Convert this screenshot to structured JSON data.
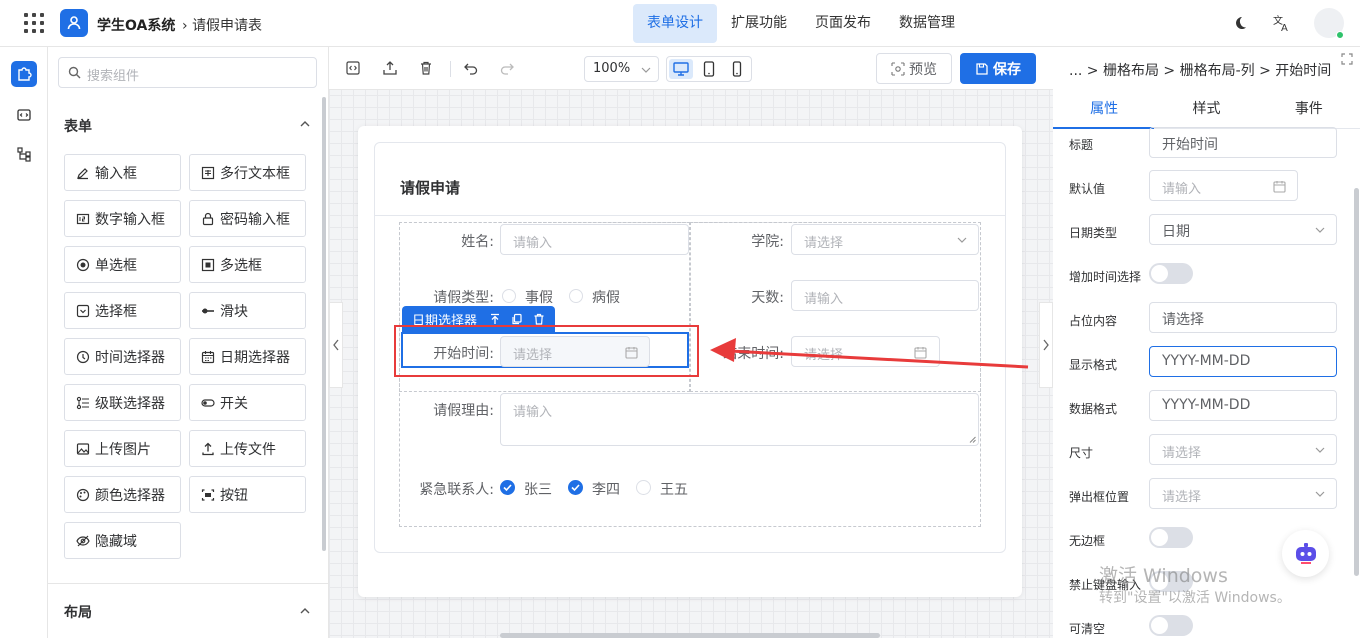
{
  "header": {
    "app_title": "学生OA系统",
    "breadcrumb": "请假申请表",
    "nav": [
      "表单设计",
      "扩展功能",
      "页面发布",
      "数据管理"
    ],
    "active_nav": 0
  },
  "components": {
    "search_placeholder": "搜索组件",
    "form_section": "表单",
    "layout_section": "布局",
    "items": [
      {
        "label": "输入框",
        "icon": "edit-icon"
      },
      {
        "label": "多行文本框",
        "icon": "textarea-icon"
      },
      {
        "label": "数字输入框",
        "icon": "number-icon"
      },
      {
        "label": "密码输入框",
        "icon": "lock-icon"
      },
      {
        "label": "单选框",
        "icon": "radio-icon"
      },
      {
        "label": "多选框",
        "icon": "checkbox-icon"
      },
      {
        "label": "选择框",
        "icon": "select-icon"
      },
      {
        "label": "滑块",
        "icon": "slider-icon"
      },
      {
        "label": "时间选择器",
        "icon": "clock-icon"
      },
      {
        "label": "日期选择器",
        "icon": "calendar-icon"
      },
      {
        "label": "级联选择器",
        "icon": "cascader-icon"
      },
      {
        "label": "开关",
        "icon": "switch-icon"
      },
      {
        "label": "上传图片",
        "icon": "image-icon"
      },
      {
        "label": "上传文件",
        "icon": "upload-icon"
      },
      {
        "label": "颜色选择器",
        "icon": "palette-icon"
      },
      {
        "label": "按钮",
        "icon": "button-icon"
      },
      {
        "label": "隐藏域",
        "icon": "eye-off-icon"
      }
    ]
  },
  "toolbar": {
    "zoom": "100%",
    "preview": "预览",
    "save": "保存"
  },
  "form": {
    "title": "请假申请",
    "name_label": "姓名:",
    "name_placeholder": "请输入",
    "college_label": "学院:",
    "college_placeholder": "请选择",
    "type_label": "请假类型:",
    "type_options": [
      "事假",
      "病假"
    ],
    "days_label": "天数:",
    "days_placeholder": "请输入",
    "selected_tag": "日期选择器",
    "start_label": "开始时间:",
    "start_placeholder": "请选择",
    "end_label": "结束时间:",
    "end_placeholder": "请选择",
    "reason_label": "请假理由:",
    "reason_placeholder": "请输入",
    "contact_label": "紧急联系人:",
    "contacts": [
      {
        "name": "张三",
        "checked": true
      },
      {
        "name": "李四",
        "checked": true
      },
      {
        "name": "王五",
        "checked": false
      }
    ]
  },
  "properties": {
    "breadcrumb": "... > 栅格布局 > 栅格布局-列 > 开始时间",
    "tabs": [
      "属性",
      "样式",
      "事件"
    ],
    "active_tab": 0,
    "title_label": "标题",
    "title_value": "开始时间",
    "default_label": "默认值",
    "default_placeholder": "请输入",
    "date_type_label": "日期类型",
    "date_type_value": "日期",
    "add_time_label": "增加时间选择",
    "placeholder_label": "占位内容",
    "placeholder_value": "请选择",
    "display_format_label": "显示格式",
    "display_format_value": "YYYY-MM-DD",
    "data_format_label": "数据格式",
    "data_format_value": "YYYY-MM-DD",
    "size_label": "尺寸",
    "size_placeholder": "请选择",
    "popup_label": "弹出框位置",
    "popup_placeholder": "请选择",
    "borderless_label": "无边框",
    "disable_kb_label": "禁止键盘输入",
    "clearable_label": "可清空"
  },
  "watermark": {
    "line1": "激活 Windows",
    "line2": "转到\"设置\"以激活 Windows。"
  },
  "colors": {
    "accent": "#1f6fe5",
    "annotation_red": "#e83b3b"
  }
}
